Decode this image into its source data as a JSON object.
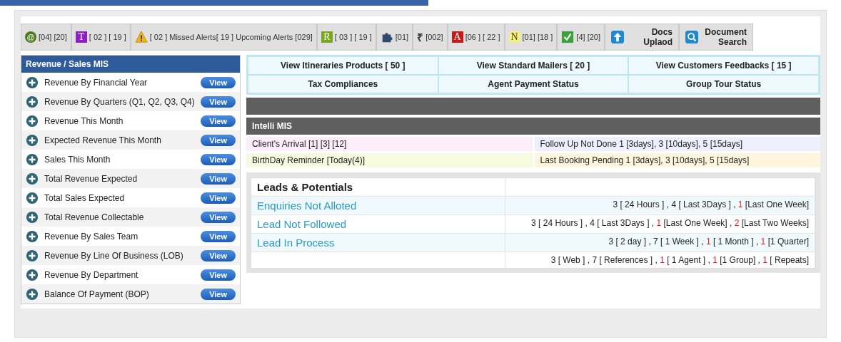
{
  "toolbar": {
    "items": [
      {
        "kind": "letter",
        "badge": "@",
        "color": "#4a7a1c",
        "text": "[04] [20]"
      },
      {
        "kind": "letter",
        "badge": "T",
        "color": "#8e1fc7",
        "text": "[ 02 ] [ 19 ]"
      },
      {
        "kind": "warning",
        "text": "[ 02 ] Missed Alerts[ 19 ] Upcoming Alerts [029]"
      },
      {
        "kind": "letter",
        "badge": "R",
        "color": "#7aa81c",
        "text": "[ 03 ] [ 19 ]"
      },
      {
        "kind": "puzzle",
        "text": "[01]"
      },
      {
        "kind": "glyph",
        "badge": "₹",
        "text": "[002]"
      },
      {
        "kind": "letter",
        "badge": "A",
        "color": "#c41a1a",
        "text": "[06 ] [ 22 ]"
      },
      {
        "kind": "letter",
        "badge": "N",
        "color": "#f3ee8c",
        "text": "[01] [18 ]"
      },
      {
        "kind": "check",
        "text": "[4] [20]"
      }
    ],
    "buttons": [
      {
        "kind": "upload",
        "label": "Docs Uplaod"
      },
      {
        "kind": "search",
        "label": "Document Search"
      }
    ]
  },
  "revenue_panel": {
    "title": "Revenue / Sales MIS",
    "items": [
      {
        "label": "Revenue By Financial Year",
        "button": "View"
      },
      {
        "label": "Revenue By Quarters (Q1, Q2, Q3, Q4)",
        "button": "View"
      },
      {
        "label": "Revenue This Month",
        "button": "View"
      },
      {
        "label": "Expected Revenue This Month",
        "button": "View"
      },
      {
        "label": "Sales This Month",
        "button": "View"
      },
      {
        "label": "Total Revenue Expected",
        "button": "View"
      },
      {
        "label": "Total Sales Expected",
        "button": "View"
      },
      {
        "label": "Total Revenue Collectable",
        "button": "View"
      },
      {
        "label": "Revenue By Sales Team",
        "button": "View"
      },
      {
        "label": "Revenue By Line Of Business (LOB)",
        "button": "View"
      },
      {
        "label": "Revenue By Department",
        "button": "View"
      },
      {
        "label": "Balance Of Payment (BOP)",
        "button": "View"
      }
    ]
  },
  "quick_links": [
    "View Itineraries Products [ 50 ]",
    "View Standard Mailers [ 20 ]",
    "View Customers Feedbacks [ 15 ]",
    "Tax Compliances",
    "Agent Payment Status",
    "Group Tour Status"
  ],
  "intelli_mis": {
    "title": "Intelli MIS",
    "items": [
      {
        "text": "Client's Arrival [1] [3] [12]",
        "color": "#fbeefa"
      },
      {
        "text": "Follow Up Not Done 1 [3days], 3 [10days], 5 [15days]",
        "color": "#eeeefc"
      },
      {
        "text": "BirthDay Reminder [Today(4)]",
        "color": "#f6fbe0"
      },
      {
        "text": "Last Booking Pending 1 [3days], 3 [10days], 5 [15days]",
        "color": "#fdf6dc"
      }
    ]
  },
  "leads": {
    "title": "Leads & Potentials",
    "rows": [
      {
        "label": "Enquiries Not Alloted",
        "value": [
          {
            "text": "3 [ 24 Hours ] , 4 [ Last 3Days ] , "
          },
          {
            "text": "1",
            "alert": true
          },
          {
            "text": " [Last One Week]"
          }
        ]
      },
      {
        "label": "Lead Not Followed",
        "value": [
          {
            "text": "3 [ 24 Hours ] , 4 [ Last 3Days ] , "
          },
          {
            "text": "1",
            "alert": true
          },
          {
            "text": " [Last One Week] , "
          },
          {
            "text": "2",
            "alert": true
          },
          {
            "text": " [Last Two Weeks]"
          }
        ]
      },
      {
        "label": "Lead In Process",
        "value": [
          {
            "text": "3 [ 2 day ] , 7 [ 1 Week ] , "
          },
          {
            "text": "1",
            "alert": true
          },
          {
            "text": " [ 1 Month ] , "
          },
          {
            "text": "1",
            "alert": true
          },
          {
            "text": " [1 Quarter]"
          }
        ]
      },
      {
        "label": "",
        "value": [
          {
            "text": "3 [ Web ] , 7 [ References ] , "
          },
          {
            "text": "1",
            "alert": true
          },
          {
            "text": " [ 1 Agent ] , "
          },
          {
            "text": "1",
            "alert": true
          },
          {
            "text": " [1 Group] , "
          },
          {
            "text": "1",
            "alert": true
          },
          {
            "text": " [ Repeats]"
          }
        ]
      }
    ]
  }
}
